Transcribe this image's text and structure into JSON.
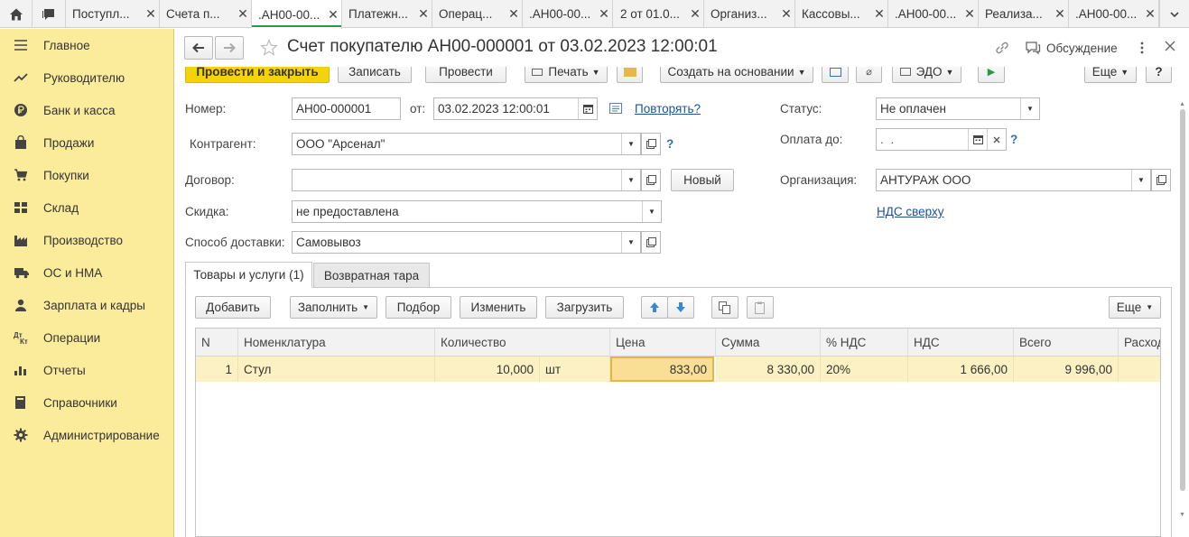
{
  "tabs": [
    {
      "label": "Поступл..."
    },
    {
      "label": "Счета п..."
    },
    {
      "label": ".АН00-00..."
    },
    {
      "label": "Платежн..."
    },
    {
      "label": "Операц..."
    },
    {
      "label": ".АН00-00..."
    },
    {
      "label": "2 от 01.0..."
    },
    {
      "label": "Организ..."
    },
    {
      "label": "Кассовы..."
    },
    {
      "label": ".АН00-00..."
    },
    {
      "label": "Реализа..."
    },
    {
      "label": ".АН00-00..."
    }
  ],
  "sidebar": {
    "items": [
      {
        "label": "Главное",
        "icon": "menu-icon"
      },
      {
        "label": "Руководителю",
        "icon": "trend-icon"
      },
      {
        "label": "Банк и касса",
        "icon": "ruble-icon"
      },
      {
        "label": "Продажи",
        "icon": "bag-icon"
      },
      {
        "label": "Покупки",
        "icon": "cart-icon"
      },
      {
        "label": "Склад",
        "icon": "warehouse-icon"
      },
      {
        "label": "Производство",
        "icon": "factory-icon"
      },
      {
        "label": "ОС и НМА",
        "icon": "truck-icon"
      },
      {
        "label": "Зарплата и кадры",
        "icon": "person-icon"
      },
      {
        "label": "Операции",
        "icon": "dt-kt-icon"
      },
      {
        "label": "Отчеты",
        "icon": "bar-chart-icon"
      },
      {
        "label": "Справочники",
        "icon": "book-icon"
      },
      {
        "label": "Администрирование",
        "icon": "gear-icon"
      }
    ]
  },
  "header": {
    "title": "Счет покупателю АН00-000001 от 03.02.2023 12:00:01",
    "discussion": "Обсуждение"
  },
  "toolbar": {
    "post_close": "Провести и закрыть",
    "save": "Записать",
    "post": "Провести",
    "print": "Печать",
    "create_based": "Создать на основании",
    "edo": "ЭДО",
    "more": "Еще"
  },
  "form": {
    "number_label": "Номер:",
    "number_value": "АН00-000001",
    "from_label": "от:",
    "date_value": "03.02.2023 12:00:01",
    "repeat_link": "Повторять?",
    "status_label": "Статус:",
    "status_value": "Не оплачен",
    "contractor_label": "Контрагент:",
    "contractor_value": "ООО \"Арсенал\"",
    "pay_until_label": "Оплата до:",
    "pay_until_value": " .  .",
    "contract_label": "Договор:",
    "contract_value": "",
    "new_button": "Новый",
    "org_label": "Организация:",
    "org_value": "АНТУРАЖ ООО",
    "discount_label": "Скидка:",
    "discount_value": "не предоставлена",
    "vat_link": "НДС сверху",
    "delivery_label": "Способ доставки:",
    "delivery_value": "Самовывоз",
    "help": "?"
  },
  "subtabs": [
    {
      "label": "Товары и услуги (1)"
    },
    {
      "label": "Возвратная тара"
    }
  ],
  "table_toolbar": {
    "add": "Добавить",
    "fill": "Заполнить",
    "pick": "Подбор",
    "change": "Изменить",
    "load": "Загрузить",
    "more": "Еще"
  },
  "table": {
    "columns": [
      "N",
      "Номенклатура",
      "Количество",
      "Цена",
      "Сумма",
      "% НДС",
      "НДС",
      "Всего",
      "Расход"
    ],
    "rows": [
      {
        "n": "1",
        "item": "Стул",
        "qty": "10,000",
        "unit": "шт",
        "price": "833,00",
        "sum": "8 330,00",
        "vat_rate": "20%",
        "vat": "1 666,00",
        "total": "9 996,00",
        "expense": ""
      }
    ]
  },
  "colors": {
    "sidebar_bg": "#fbec9c",
    "primary_button": "#f5d30b",
    "active_tab_underline": "#2a9a46",
    "link": "#1e4f9a"
  }
}
